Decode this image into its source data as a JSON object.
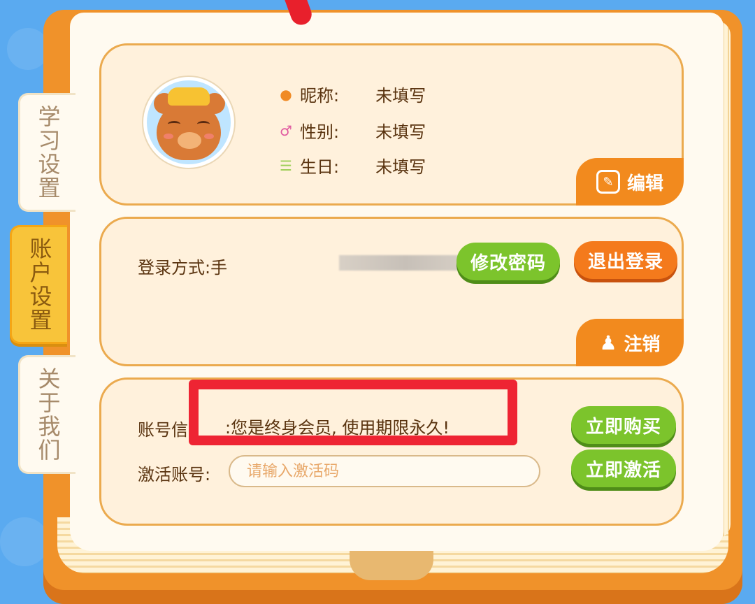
{
  "tabs": [
    {
      "label": "学习设置",
      "active": false
    },
    {
      "label": "账户设置",
      "active": true
    },
    {
      "label": "关于我们",
      "active": false
    }
  ],
  "profile": {
    "avatar_icon": "bear-avatar",
    "nickname_label": "昵称:",
    "nickname_value": "未填写",
    "gender_label": "性别:",
    "gender_value": "未填写",
    "birthday_label": "生日:",
    "birthday_value": "未填写",
    "edit_label": "编辑"
  },
  "account": {
    "login_label": "登录方式:手",
    "change_password_label": "修改密码",
    "logout_label": "退出登录",
    "cancel_account_label": "注销"
  },
  "membership": {
    "account_info_label": "账号信",
    "account_info_value": ":您是终身会员, 使用期限永久!",
    "buy_label": "立即购买",
    "activate_label": "激活账号:",
    "activate_placeholder": "请输入激活码",
    "activate_button_label": "立即激活"
  },
  "colors": {
    "sky": "#5aaaf0",
    "book_cover": "#f0922a",
    "card_bg": "#fff1dc",
    "green_button": "#7cc42c",
    "orange_button": "#f47a1c",
    "highlight": "#ee2433"
  }
}
